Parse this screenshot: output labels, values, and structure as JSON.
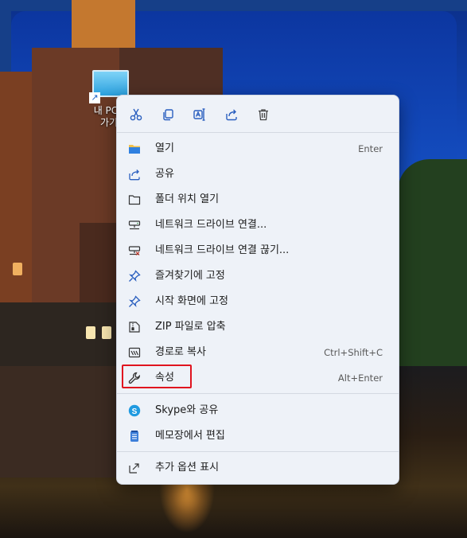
{
  "desktop": {
    "icon_label": "내 PC -\n가기"
  },
  "toolbar": {
    "buttons": [
      {
        "icon": "cut-icon",
        "label": "잘라내기"
      },
      {
        "icon": "copy-icon",
        "label": "복사"
      },
      {
        "icon": "rename-icon",
        "label": "이름 바꾸기"
      },
      {
        "icon": "share-icon",
        "label": "공유"
      },
      {
        "icon": "delete-icon",
        "label": "삭제"
      }
    ]
  },
  "menu": {
    "items": [
      {
        "label": "열기",
        "shortcut": "Enter",
        "icon": "open-folder-icon"
      },
      {
        "label": "공유",
        "shortcut": "",
        "icon": "share-icon"
      },
      {
        "label": "폴더 위치 열기",
        "shortcut": "",
        "icon": "folder-icon"
      },
      {
        "label": "네트워크 드라이브 연결...",
        "shortcut": "",
        "icon": "network-drive-icon"
      },
      {
        "label": "네트워크 드라이브 연결 끊기...",
        "shortcut": "",
        "icon": "network-drive-disconnect-icon"
      },
      {
        "label": "즐겨찾기에 고정",
        "shortcut": "",
        "icon": "pin-icon"
      },
      {
        "label": "시작 화면에 고정",
        "shortcut": "",
        "icon": "pin-icon"
      },
      {
        "label": "ZIP 파일로 압축",
        "shortcut": "",
        "icon": "zip-icon"
      },
      {
        "label": "경로로 복사",
        "shortcut": "Ctrl+Shift+C",
        "icon": "copy-path-icon"
      },
      {
        "label": "속성",
        "shortcut": "Alt+Enter",
        "icon": "wrench-icon"
      },
      {
        "label": "Skype와 공유",
        "shortcut": "",
        "icon": "skype-icon"
      },
      {
        "label": "메모장에서 편집",
        "shortcut": "",
        "icon": "notepad-icon"
      },
      {
        "label": "추가 옵션 표시",
        "shortcut": "",
        "icon": "more-options-icon"
      }
    ]
  },
  "colors": {
    "highlight_border": "#e0141f",
    "accent": "#1e63c8"
  }
}
